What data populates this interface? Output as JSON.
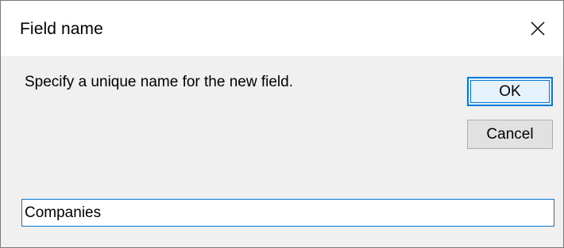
{
  "dialog": {
    "title": "Field name",
    "close_icon": "close-icon",
    "prompt": "Specify a unique name for the new field.",
    "ok_label": "OK",
    "cancel_label": "Cancel",
    "field_value": "Companies",
    "accent_color": "#0078d7"
  }
}
